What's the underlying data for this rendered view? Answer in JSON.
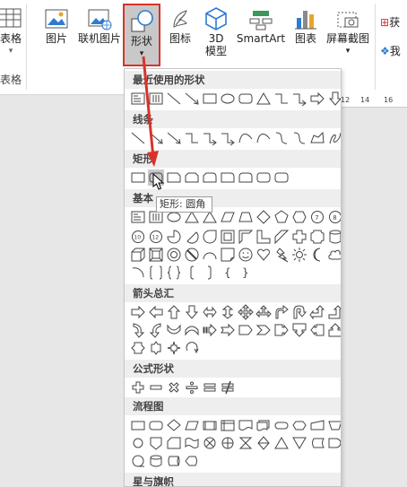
{
  "ribbon": {
    "table_label": "表格",
    "table_group": "表格",
    "picture_label": "图片",
    "online_picture_label": "联机图片",
    "shapes_label": "形状",
    "icons_label": "图标",
    "model3d_label_1": "3D",
    "model3d_label_2": "模型",
    "smartart_label": "SmartArt",
    "chart_label": "图表",
    "screenshot_label": "屏幕截图",
    "addin_label_1": "获",
    "addin_label_2": "我"
  },
  "ruler": {
    "n1": "12",
    "n2": "14",
    "n3": "16"
  },
  "panel": {
    "recent_header": "最近使用的形状",
    "lines_header": "线条",
    "rect_header": "矩形",
    "basic_header": "基本",
    "arrows_header": "箭头总汇",
    "equation_header": "公式形状",
    "flowchart_header": "流程图",
    "stars_header": "星与旗帜"
  },
  "tooltip": {
    "text": "矩形: 圆角"
  },
  "colors": {
    "accent": "#d9322b",
    "icon": "#444444",
    "selected": "#c8c8c8"
  }
}
